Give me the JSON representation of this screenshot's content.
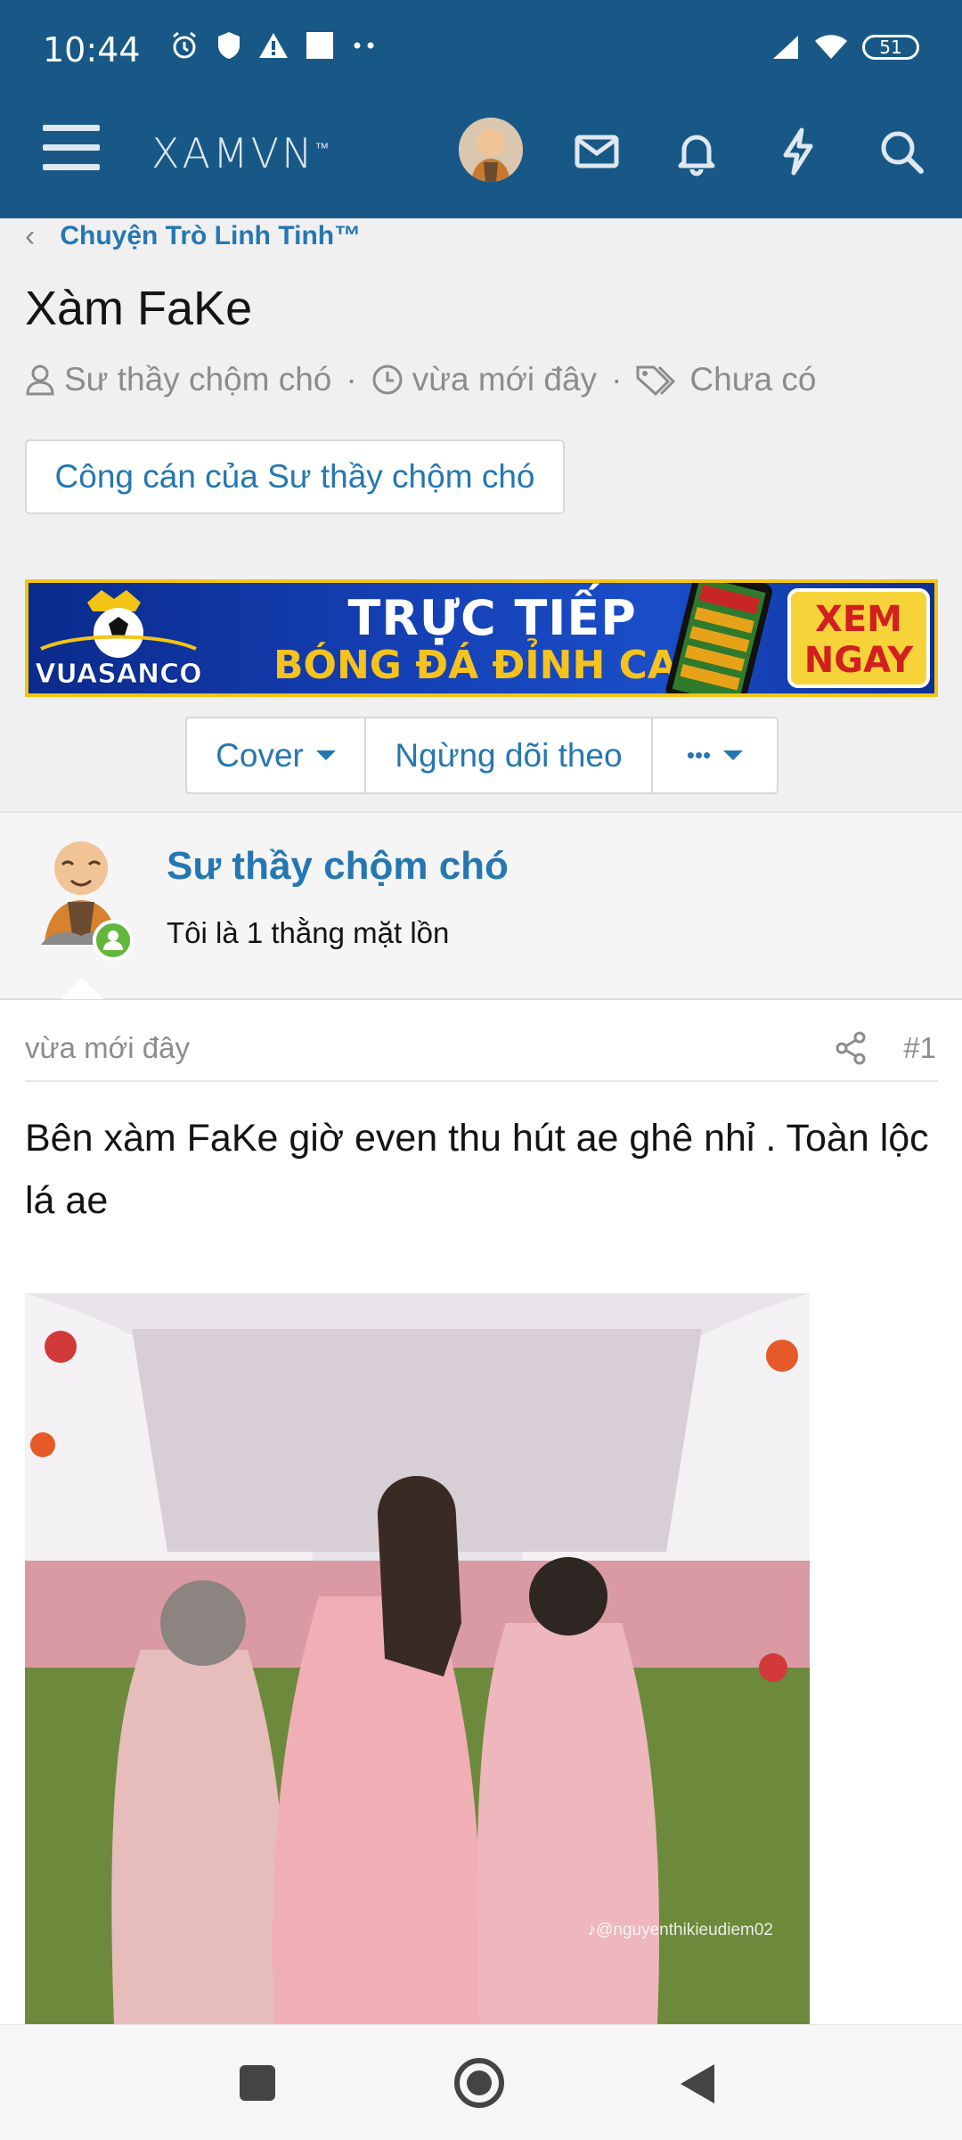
{
  "status_bar": {
    "time": "10:44",
    "battery": "51"
  },
  "app_bar": {
    "logo": "XAMVN",
    "logo_tm": "™"
  },
  "breadcrumb": {
    "parent": "Chuyện Trò Linh Tinh™"
  },
  "thread": {
    "title": "Xàm FaKe",
    "author": "Sư thầy chộm chó",
    "time": "vừa mới đây",
    "tags": "Chưa có",
    "author_posts_button": "Công cán của Sư thầy chộm chó"
  },
  "ad": {
    "brand": "VUASANCO",
    "line1": "TRỰC TIẾP",
    "line2": "BÓNG ĐÁ ĐỈNH CAO",
    "cta_line1": "XEM",
    "cta_line2": "NGAY"
  },
  "actions": {
    "cover": "Cover",
    "unwatch": "Ngừng dõi theo",
    "more": "•••"
  },
  "post": {
    "author_name": "Sư thầy chộm chó",
    "author_title": "Tôi là 1 thằng mặt lồn",
    "time": "vừa mới đây",
    "number": "#1",
    "body": "Bên xàm FaKe giờ even thu hút ae ghê nhỉ . Toàn lộc lá ae",
    "image_credit": "♪@nguyenthikieudiem02"
  },
  "colors": {
    "header_bg": "#185886",
    "link": "#2577b1",
    "online": "#63b63c"
  }
}
